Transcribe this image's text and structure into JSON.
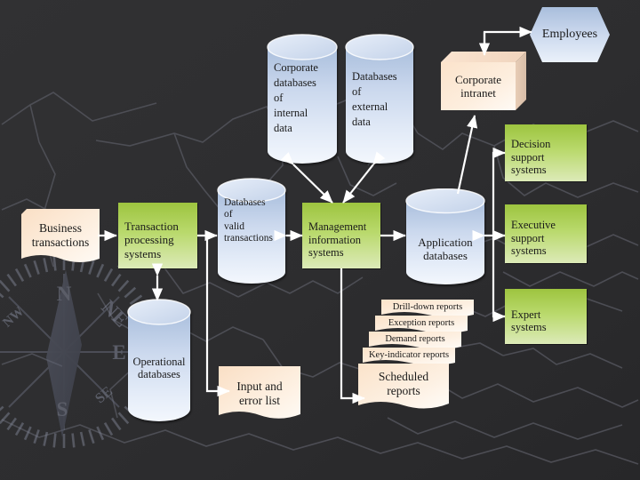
{
  "slide": {
    "background_color": "#2e2e30",
    "accent_green": "#9dc43f",
    "accent_cream": "#fce6d0",
    "accent_blue": "#cfdcf0",
    "connector_color": "#ffffff",
    "watermark": "compass-rose"
  },
  "nodes": {
    "business_transactions": {
      "label": "Business\ntransactions",
      "shape": "document"
    },
    "transaction_processing": {
      "label": "Transaction\nprocessing\nsystems",
      "shape": "process-box"
    },
    "databases_valid": {
      "label": "Databases\nof\nvalid\ntransactions",
      "shape": "cylinder"
    },
    "management_info": {
      "label": "Management\ninformation\nsystems",
      "shape": "process-box"
    },
    "application_databases": {
      "label": "Application\ndatabases",
      "shape": "cylinder"
    },
    "corporate_internal": {
      "label": "Corporate\ndatabases\nof\ninternal\ndata",
      "shape": "cylinder"
    },
    "databases_external": {
      "label": "Databases\nof\nexternal\ndata",
      "shape": "cylinder"
    },
    "corporate_intranet": {
      "label": "Corporate\nintranet",
      "shape": "cube"
    },
    "employees": {
      "label": "Employees",
      "shape": "hexagon"
    },
    "decision_support": {
      "label": "Decision\nsupport\nsystems",
      "shape": "process-box"
    },
    "executive_support": {
      "label": "Executive\nsupport\nsystems",
      "shape": "process-box"
    },
    "expert_systems": {
      "label": "Expert\nsystems",
      "shape": "process-box"
    },
    "operational_databases": {
      "label": "Operational\ndatabases",
      "shape": "cylinder"
    },
    "input_error_list": {
      "label": "Input and\nerror list",
      "shape": "document"
    }
  },
  "report_stack": {
    "items": [
      "Drill-down reports",
      "Exception reports",
      "Demand reports",
      "Key-indicator reports"
    ],
    "front_label": "Scheduled\nreports"
  },
  "compass": {
    "directions": [
      "N",
      "NE",
      "E",
      "SE",
      "S",
      "NW"
    ]
  }
}
